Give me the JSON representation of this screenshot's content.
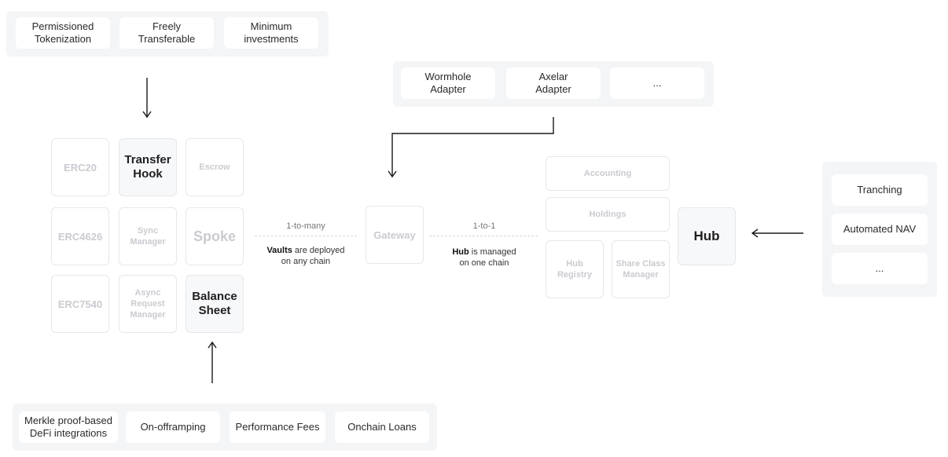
{
  "top_left_panel": {
    "items": [
      "Permissioned\nTokenization",
      "Freely\nTransferable",
      "Minimum\ninvestments"
    ]
  },
  "top_right_panel": {
    "items": [
      "Wormhole\nAdapter",
      "Axelar\nAdapter",
      "..."
    ]
  },
  "spoke_grid": {
    "cells": [
      {
        "label": "ERC20",
        "style": "faded"
      },
      {
        "label": "Transfer\nHook",
        "style": "strong"
      },
      {
        "label": "Escrow",
        "style": "faded"
      },
      {
        "label": "ERC4626",
        "style": "faded"
      },
      {
        "label": "Sync\nManager",
        "style": "faded-small"
      },
      {
        "label": "Spoke",
        "style": "faded-large"
      },
      {
        "label": "ERC7540",
        "style": "faded"
      },
      {
        "label": "Async\nRequest\nManager",
        "style": "faded-small"
      },
      {
        "label": "Balance\nSheet",
        "style": "strong"
      }
    ]
  },
  "connector_left": {
    "title": "1-to-many",
    "bold": "Vaults",
    "rest": " are deployed",
    "line2": "on any chain"
  },
  "gateway": {
    "label": "Gateway"
  },
  "connector_right": {
    "title": "1-to-1",
    "bold": "Hub",
    "rest": " is managed",
    "line2": "on one chain"
  },
  "hub_group": {
    "accounting": "Accounting",
    "holdings": "Holdings",
    "hub_registry": "Hub\nRegistry",
    "share_class_manager": "Share Class\nManager"
  },
  "hub": {
    "label": "Hub"
  },
  "right_panel": {
    "items": [
      "Tranching",
      "Automated NAV",
      "..."
    ]
  },
  "bottom_panel": {
    "items": [
      "Merkle proof-based\nDeFi integrations",
      "On-offramping",
      "Performance Fees",
      "Onchain Loans"
    ]
  }
}
